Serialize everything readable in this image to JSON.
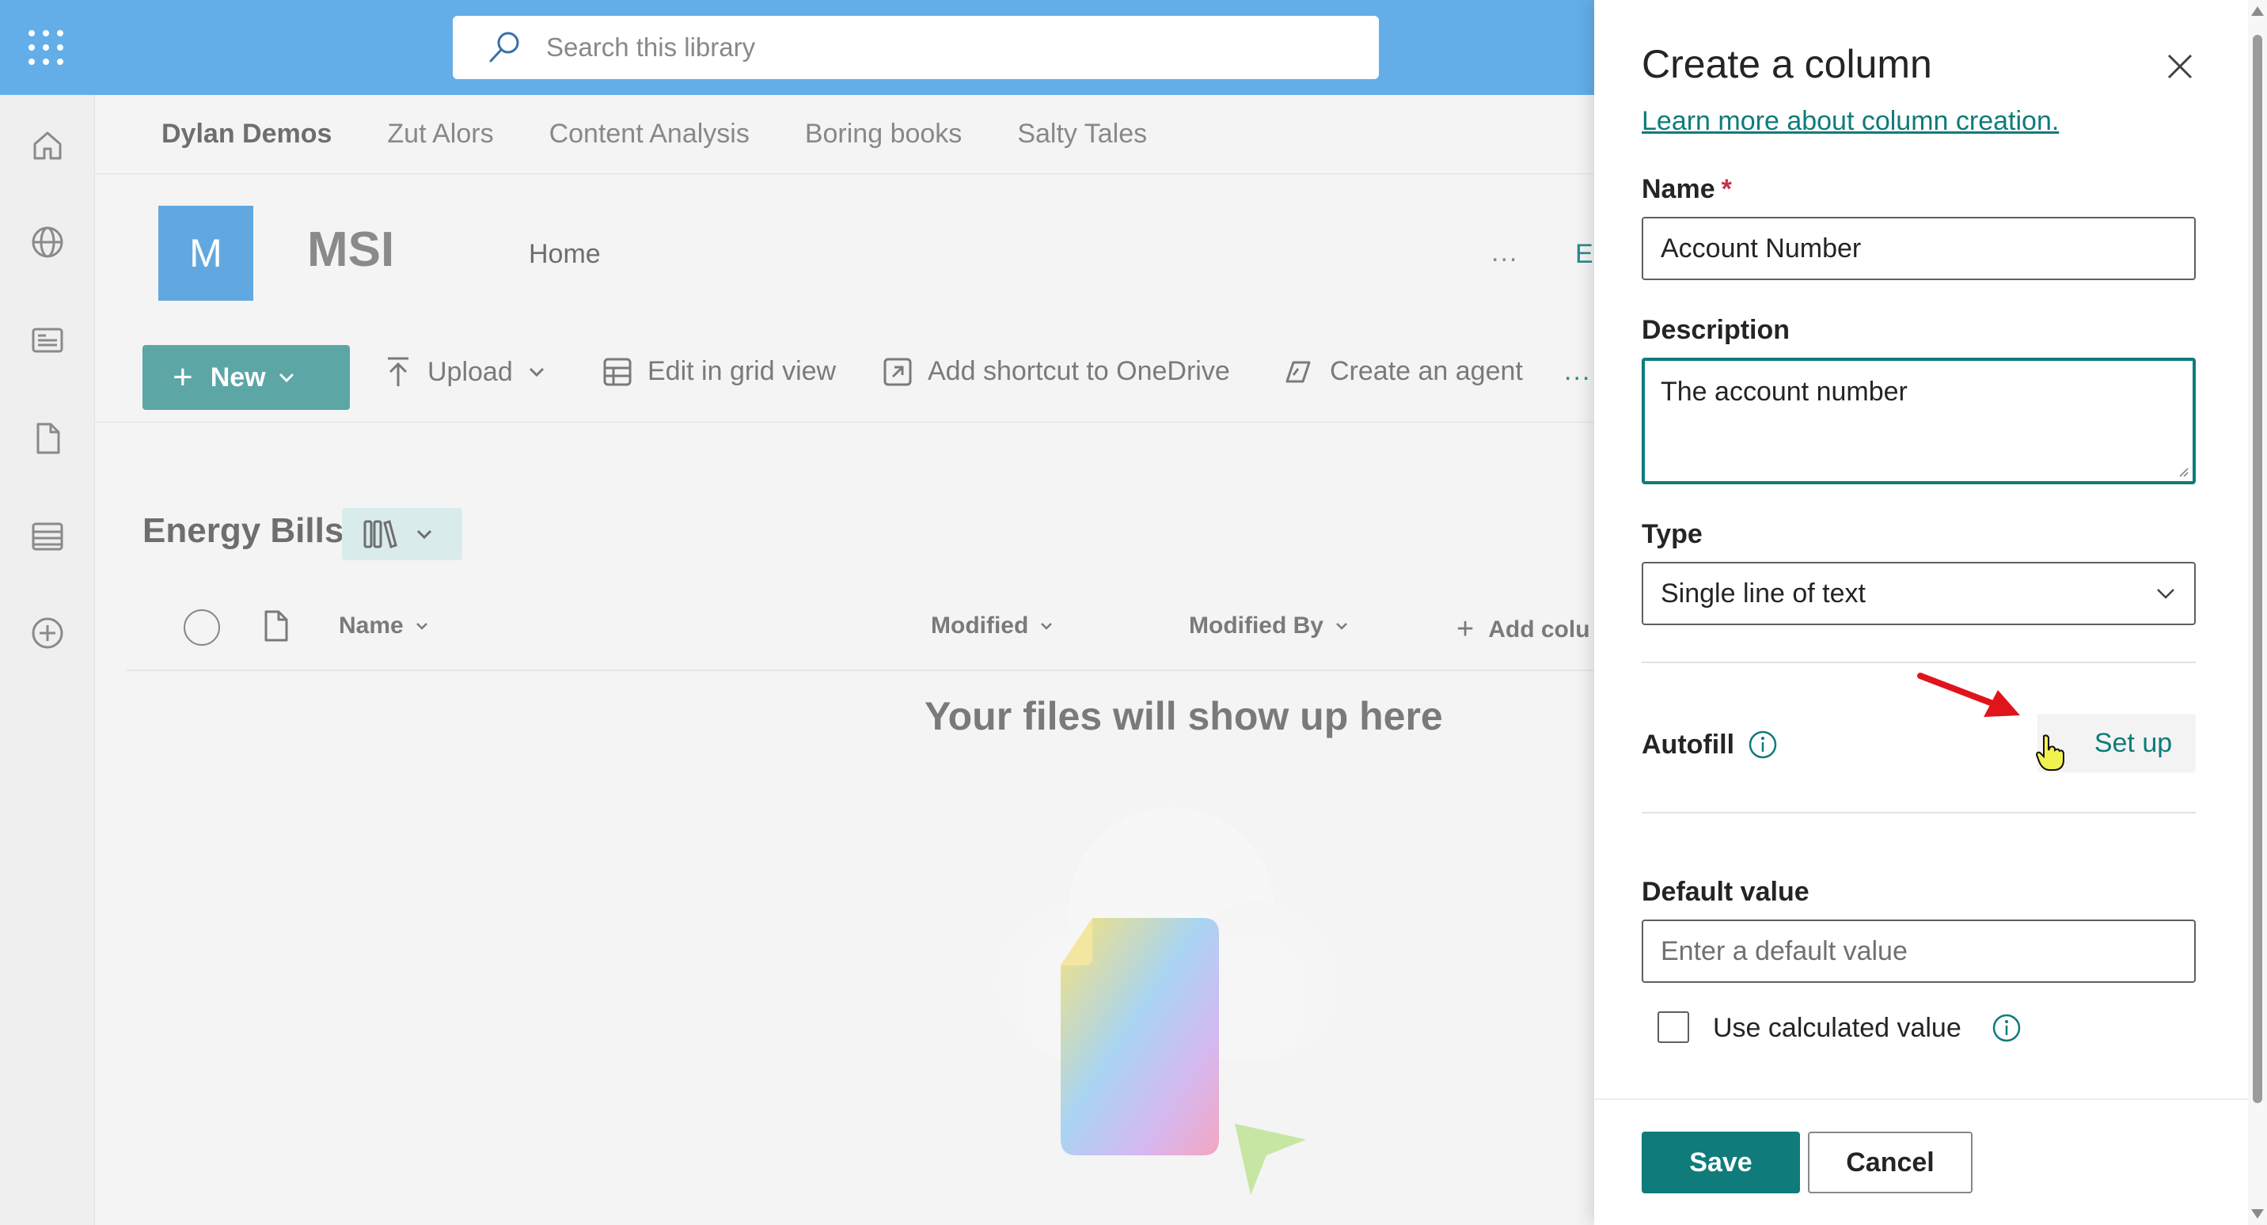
{
  "topbar": {
    "search_placeholder": "Search this library"
  },
  "hubnav": {
    "items": [
      "Dylan Demos",
      "Zut Alors",
      "Content Analysis",
      "Boring books",
      "Salty Tales"
    ]
  },
  "site": {
    "logo_letter": "M",
    "title": "MSI",
    "home": "Home",
    "more": "...",
    "edit": "Ed"
  },
  "commands": {
    "new": "New",
    "upload": "Upload",
    "edit_grid": "Edit in grid view",
    "shortcut": "Add shortcut to OneDrive",
    "agent": "Create an agent",
    "more": "..."
  },
  "library": {
    "title": "Energy Bills",
    "columns": {
      "name": "Name",
      "modified": "Modified",
      "modified_by": "Modified By",
      "add_column": "Add colu"
    },
    "empty_message": "Your files will show up here"
  },
  "panel": {
    "title": "Create a column",
    "learn_link": "Learn more about column creation.",
    "name_label": "Name",
    "required_mark": "*",
    "name_value": "Account Number",
    "description_label": "Description",
    "description_value": "The account number",
    "type_label": "Type",
    "type_value": "Single line of text",
    "autofill_label": "Autofill",
    "setup_label": "Set up",
    "default_label": "Default value",
    "default_placeholder": "Enter a default value",
    "calc_label": "Use calculated value",
    "save": "Save",
    "cancel": "Cancel"
  },
  "colors": {
    "topbar": "#63aee8",
    "accent": "#0f7b7b",
    "new_button": "#5ca6a6",
    "annotation_arrow": "#e0141b"
  }
}
